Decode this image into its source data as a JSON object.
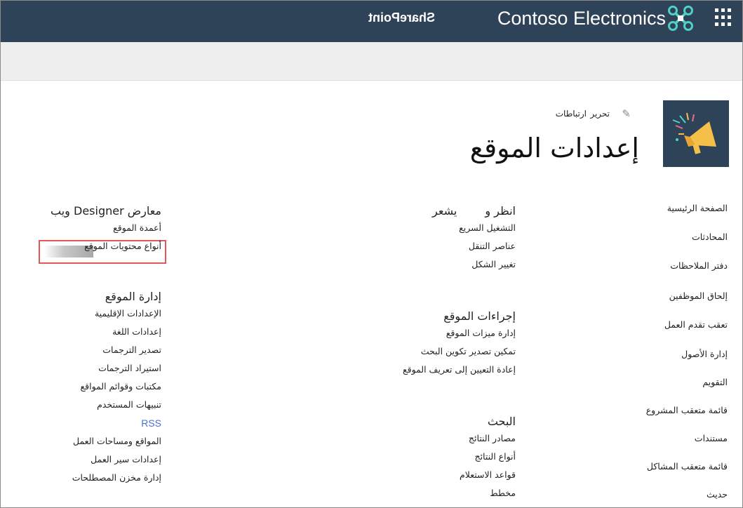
{
  "suite_bar": {
    "org_name": "Contoso Electronics",
    "product_name": "SharePoint",
    "app_launcher_icon": "waffle-icon",
    "brand_icon": "drone-icon",
    "background_color": "#2f4358"
  },
  "header": {
    "site_logo_icon": "megaphone-icon",
    "edit_label": "تحرير",
    "links_label": "ارتباطات",
    "edit_icon": "pencil-icon",
    "page_title": "إعدادات الموقع"
  },
  "left_nav": {
    "items": [
      {
        "label": "الصفحة الرئيسية"
      },
      {
        "label": "المحادثات"
      },
      {
        "label": "دفتر الملاحظات"
      },
      {
        "label": "إلحاق الموظفين"
      },
      {
        "label": "تعقب تقدم العمل"
      },
      {
        "label": "إدارة الأصول"
      },
      {
        "label": "التقويم"
      },
      {
        "label": "قائمة متعقب المشروع"
      },
      {
        "label": "مستندات"
      },
      {
        "label": "قائمة متعقب المشاكل"
      },
      {
        "label": "حديث"
      }
    ]
  },
  "look_and_feel": {
    "heading_part1": "انظر و",
    "heading_part2": "يشعر",
    "links": [
      "التشغيل السريع",
      "عناصر التنقل",
      "تغيير الشكل"
    ]
  },
  "site_actions": {
    "heading": "إجراءات الموقع",
    "links": [
      "إدارة ميزات الموقع",
      "تمكين تصدير تكوين البحث",
      "إعادة التعيين إلى تعريف الموقع"
    ]
  },
  "search": {
    "heading": "البحث",
    "links": [
      "مصادر النتائج",
      "أنواع النتائج",
      "قواعد الاستعلام",
      "مخطط"
    ]
  },
  "web_designer_galleries": {
    "heading": "معارض Designer ويب",
    "links": [
      "أعمدة الموقع",
      "أنواع محتويات الموقع"
    ],
    "highlight_color": "#e05858"
  },
  "site_administration": {
    "heading": "إدارة الموقع",
    "links": [
      "الإعدادات الإقليمية",
      "إعدادات اللغة",
      "تصدير الترجمات",
      "استيراد الترجمات",
      "مكتبات وقوائم المواقع",
      "تنبيهات المستخدم",
      "RSS",
      "المواقع ومساحات العمل",
      "إعدادات سير العمل",
      "إدارة مخزن المصطلحات"
    ],
    "rss_color": "#4a6fd1"
  }
}
